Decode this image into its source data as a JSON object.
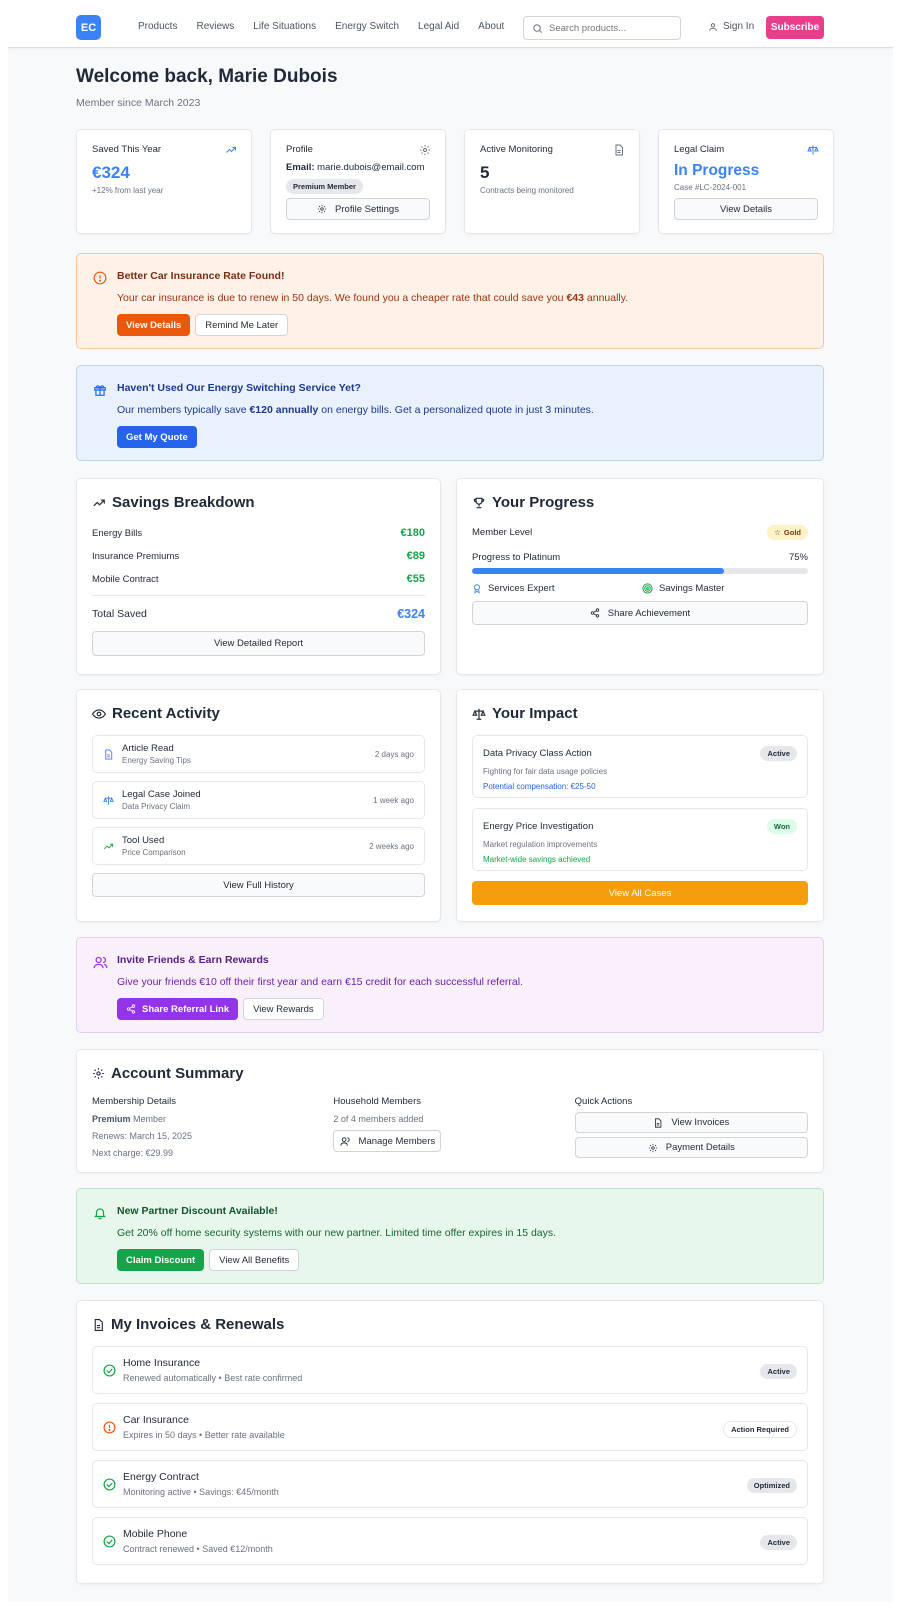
{
  "nav": {
    "logo": "EC",
    "links": [
      "Products",
      "Reviews",
      "Life Situations",
      "Energy Switch",
      "Legal Aid",
      "About"
    ],
    "search_placeholder": "Search products...",
    "signin": "Sign In",
    "subscribe": "Subscribe"
  },
  "header": {
    "title": "Welcome back, Marie Dubois",
    "since": "Member since March 2023"
  },
  "stats": {
    "saved": {
      "label": "Saved This Year",
      "value": "€324",
      "sub": "+12% from last year"
    },
    "profile": {
      "label": "Profile",
      "email_label": "Email:",
      "email": "marie.dubois@email.com",
      "badge": "Premium Member",
      "button": "Profile Settings"
    },
    "monitoring": {
      "label": "Active Monitoring",
      "value": "5",
      "sub": "Contracts being monitored"
    },
    "legal": {
      "label": "Legal Claim",
      "value": "In Progress",
      "sub": "Case #LC-2024-001",
      "button": "View Details"
    }
  },
  "car_alert": {
    "title": "Better Car Insurance Rate Found!",
    "text_pre": "Your car insurance is due to renew in 50 days. We found you a cheaper rate that could save you ",
    "text_bold": "€43",
    "text_post": " annually.",
    "primary": "View Details",
    "secondary": "Remind Me Later"
  },
  "energy_alert": {
    "title": "Haven't Used Our Energy Switching Service Yet?",
    "text_pre": "Our members typically save ",
    "text_bold": "€120 annually",
    "text_post": " on energy bills. Get a personalized quote in just 3 minutes.",
    "primary": "Get My Quote"
  },
  "savings": {
    "title": "Savings Breakdown",
    "rows": [
      {
        "label": "Energy Bills",
        "value": "€180"
      },
      {
        "label": "Insurance Premiums",
        "value": "€89"
      },
      {
        "label": "Mobile Contract",
        "value": "€55"
      }
    ],
    "total_label": "Total Saved",
    "total_value": "€324",
    "button": "View Detailed Report"
  },
  "progress": {
    "title": "Your Progress",
    "level_label": "Member Level",
    "level_badge": "Gold",
    "to_label": "Progress to Platinum",
    "percent_text": "75%",
    "percent": 0.75,
    "achievements": [
      "Services Expert",
      "Savings Master"
    ],
    "button": "Share Achievement"
  },
  "activity": {
    "title": "Recent Activity",
    "items": [
      {
        "title": "Article Read",
        "sub": "Energy Saving Tips",
        "time": "2 days ago"
      },
      {
        "title": "Legal Case Joined",
        "sub": "Data Privacy Claim",
        "time": "1 week ago"
      },
      {
        "title": "Tool Used",
        "sub": "Price Comparison",
        "time": "2 weeks ago"
      }
    ],
    "button": "View Full History"
  },
  "impact": {
    "title": "Your Impact",
    "items": [
      {
        "title": "Data Privacy Class Action",
        "badge": "Active",
        "sub": "Fighting for fair data usage policies",
        "note": "Potential compensation: €25-50"
      },
      {
        "title": "Energy Price Investigation",
        "badge": "Won",
        "sub": "Market regulation improvements",
        "note": "Market-wide savings achieved"
      }
    ],
    "button": "View All Cases"
  },
  "referral": {
    "title": "Invite Friends & Earn Rewards",
    "text": "Give your friends €10 off their first year and earn €15 credit for each successful referral.",
    "primary": "Share Referral Link",
    "secondary": "View Rewards"
  },
  "account": {
    "title": "Account Summary",
    "membership": {
      "heading": "Membership Details",
      "plan_bold": "Premium",
      "plan_rest": " Member",
      "renews": "Renews: March 15, 2025",
      "next": "Next charge: €29.99"
    },
    "household": {
      "heading": "Household Members",
      "count": "2 of 4 members added",
      "button": "Manage Members"
    },
    "quick": {
      "heading": "Quick Actions",
      "invoices": "View Invoices",
      "payment": "Payment Details"
    }
  },
  "partner": {
    "title": "New Partner Discount Available!",
    "text": "Get 20% off home security systems with our new partner. Limited time offer expires in 15 days.",
    "primary": "Claim Discount",
    "secondary": "View All Benefits"
  },
  "invoices": {
    "title": "My Invoices & Renewals",
    "items": [
      {
        "title": "Home Insurance",
        "sub": "Renewed automatically • Best rate confirmed",
        "badge": "Active",
        "icon": "check-circle-icon"
      },
      {
        "title": "Car Insurance",
        "sub": "Expires in 50 days • Better rate available",
        "badge": "Action Required",
        "icon": "alert-circle-icon"
      },
      {
        "title": "Energy Contract",
        "sub": "Monitoring active • Savings: €45/month",
        "badge": "Optimized",
        "icon": "check-circle-icon"
      },
      {
        "title": "Mobile Phone",
        "sub": "Contract renewed • Saved €12/month",
        "badge": "Active",
        "icon": "check-circle-icon"
      }
    ]
  },
  "colors": {
    "brand": "#3b82f6",
    "subscribe": "#e83e8c",
    "orange": "#ea580c",
    "blue_btn": "#2563eb",
    "purple": "#9333ea",
    "green": "#16a34a",
    "amber": "#f59e0b"
  }
}
